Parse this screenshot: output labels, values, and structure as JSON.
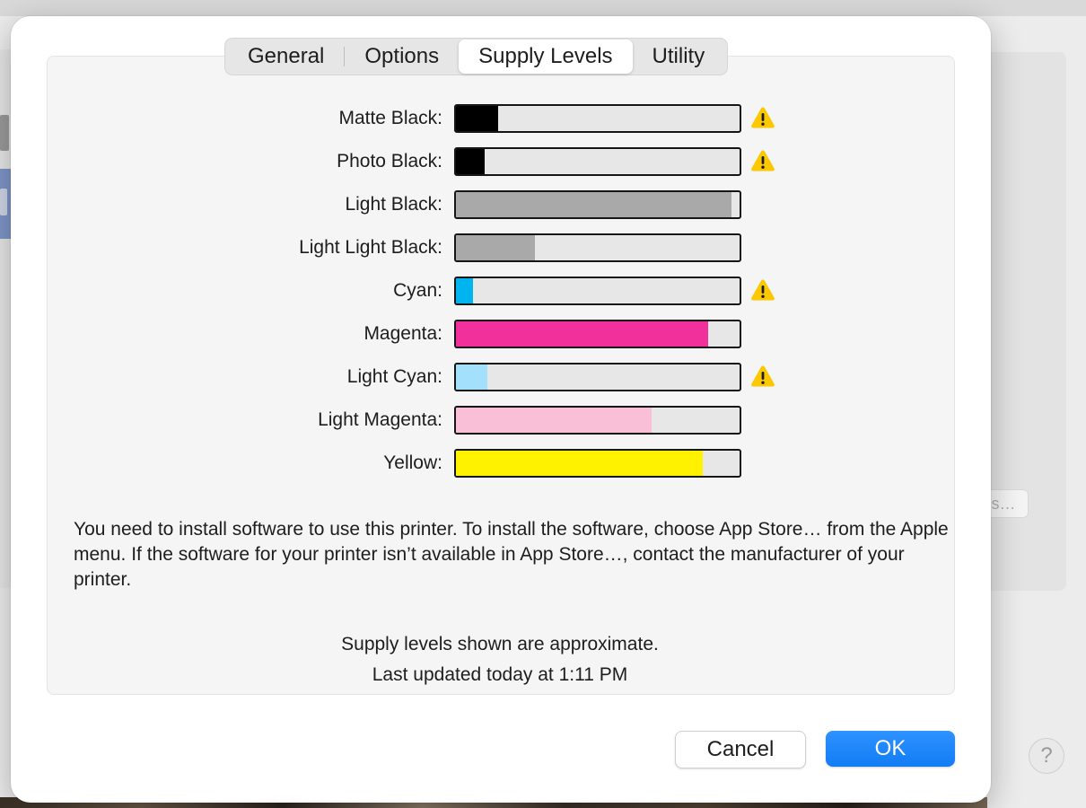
{
  "dialog": {
    "tabs": [
      {
        "label": "General",
        "selected": false
      },
      {
        "label": "Options",
        "selected": false
      },
      {
        "label": "Supply Levels",
        "selected": true
      },
      {
        "label": "Utility",
        "selected": false
      }
    ],
    "supplies": [
      {
        "label": "Matte Black:",
        "level": 0.15,
        "color": "#000000",
        "warning": true
      },
      {
        "label": "Photo Black:",
        "level": 0.1,
        "color": "#000000",
        "warning": true
      },
      {
        "label": "Light Black:",
        "level": 0.97,
        "color": "#a9a9a9",
        "warning": false
      },
      {
        "label": "Light Light Black:",
        "level": 0.28,
        "color": "#a9a9a9",
        "warning": false
      },
      {
        "label": "Cyan:",
        "level": 0.06,
        "color": "#00b4f0",
        "warning": true
      },
      {
        "label": "Magenta:",
        "level": 0.89,
        "color": "#f2309b",
        "warning": false
      },
      {
        "label": "Light Cyan:",
        "level": 0.11,
        "color": "#a3e0fb",
        "warning": true
      },
      {
        "label": "Light Magenta:",
        "level": 0.69,
        "color": "#f9bfd6",
        "warning": false
      },
      {
        "label": "Yellow:",
        "level": 0.87,
        "color": "#fff200",
        "warning": false
      }
    ],
    "warning_icon": "warning-triangle-icon",
    "warning_color": "#fcc800",
    "message": "You need to install software to use this printer. To install the software, choose App Store… from the Apple menu. If the software for your printer isn’t available in App Store…, contact the manufacturer of your printer.",
    "approx_note": "Supply levels shown are approximate.",
    "last_updated": "Last updated today at 1:11 PM",
    "cancel_label": "Cancel",
    "ok_label": "OK",
    "accent_color": "#1a85ff"
  },
  "background": {
    "side_button_label": "s…",
    "help_label": "?"
  }
}
